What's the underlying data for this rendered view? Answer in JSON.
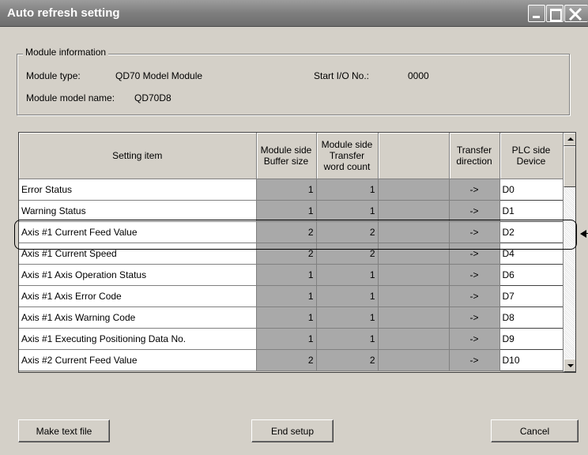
{
  "window": {
    "title": "Auto refresh setting"
  },
  "module_info": {
    "legend": "Module information",
    "type_label": "Module type:",
    "type_value": "QD70 Model Module",
    "start_io_label": "Start I/O No.:",
    "start_io_value": "0000",
    "model_name_label": "Module model name:",
    "model_name_value": "QD70D8"
  },
  "grid": {
    "headers": {
      "setting_item": "Setting item",
      "buffer_size": "Module side Buffer size",
      "transfer_count": "Module side Transfer word count",
      "blank": "",
      "transfer_direction": "Transfer direction",
      "plc_device": "PLC side Device"
    },
    "rows": [
      {
        "item": "Error Status",
        "buffer": "1",
        "count": "1",
        "dir": "->",
        "device": "D0"
      },
      {
        "item": "Warning Status",
        "buffer": "1",
        "count": "1",
        "dir": "->",
        "device": "D1"
      },
      {
        "item": "Axis #1 Current Feed Value",
        "buffer": "2",
        "count": "2",
        "dir": "->",
        "device": "D2"
      },
      {
        "item": "Axis #1 Current Speed",
        "buffer": "2",
        "count": "2",
        "dir": "->",
        "device": "D4"
      },
      {
        "item": "Axis #1 Axis Operation Status",
        "buffer": "1",
        "count": "1",
        "dir": "->",
        "device": "D6"
      },
      {
        "item": "Axis #1 Axis Error Code",
        "buffer": "1",
        "count": "1",
        "dir": "->",
        "device": "D7"
      },
      {
        "item": "Axis #1 Axis Warning Code",
        "buffer": "1",
        "count": "1",
        "dir": "->",
        "device": "D8"
      },
      {
        "item": "Axis #1 Executing Positioning Data No.",
        "buffer": "1",
        "count": "1",
        "dir": "->",
        "device": "D9"
      },
      {
        "item": "Axis #2 Current Feed Value",
        "buffer": "2",
        "count": "2",
        "dir": "->",
        "device": "D10"
      }
    ]
  },
  "buttons": {
    "make_text_file": "Make text file",
    "end_setup": "End setup",
    "cancel": "Cancel"
  }
}
